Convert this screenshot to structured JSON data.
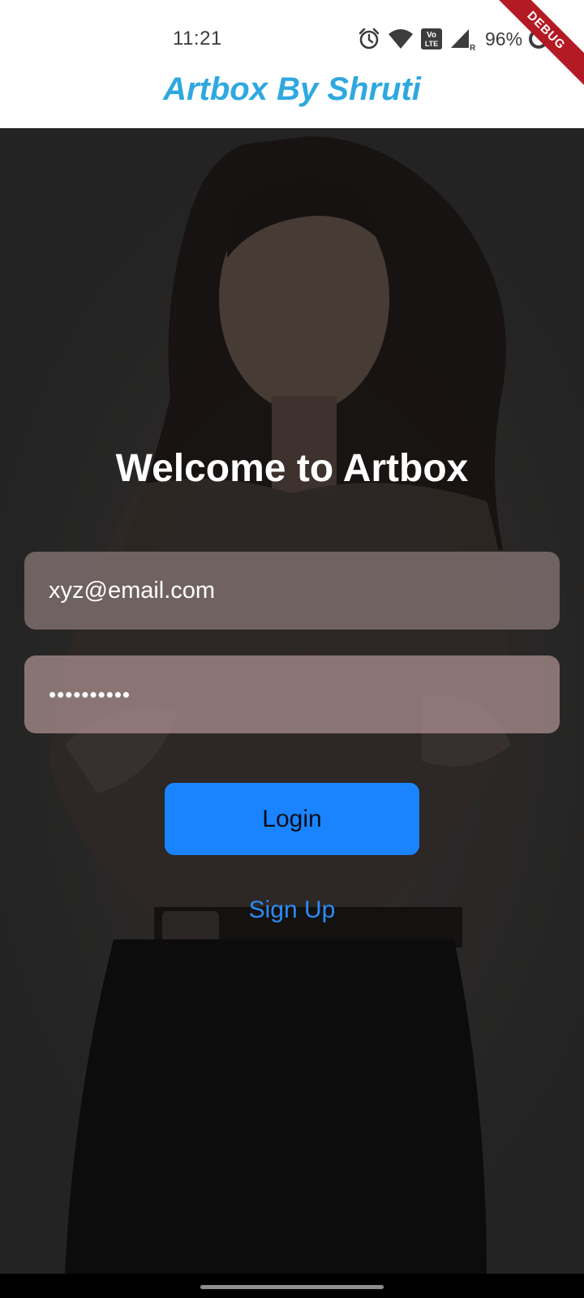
{
  "status_bar": {
    "time": "11:21",
    "battery_percent": "96%",
    "icons": [
      "alarm-icon",
      "wifi-icon",
      "volte-icon",
      "signal-icon",
      "battery-icon"
    ],
    "volte_label": "Vo LTE",
    "roaming_label": "R"
  },
  "debug_banner": "DEBUG",
  "app_bar": {
    "title": "Artbox By Shruti",
    "title_color": "#2fa8e0"
  },
  "login": {
    "welcome": "Welcome to Artbox",
    "email_value": "xyz@email.com",
    "password_masked": "••••••••••",
    "login_label": "Login",
    "signup_label": "Sign Up",
    "accent_color": "#1a84ff"
  }
}
